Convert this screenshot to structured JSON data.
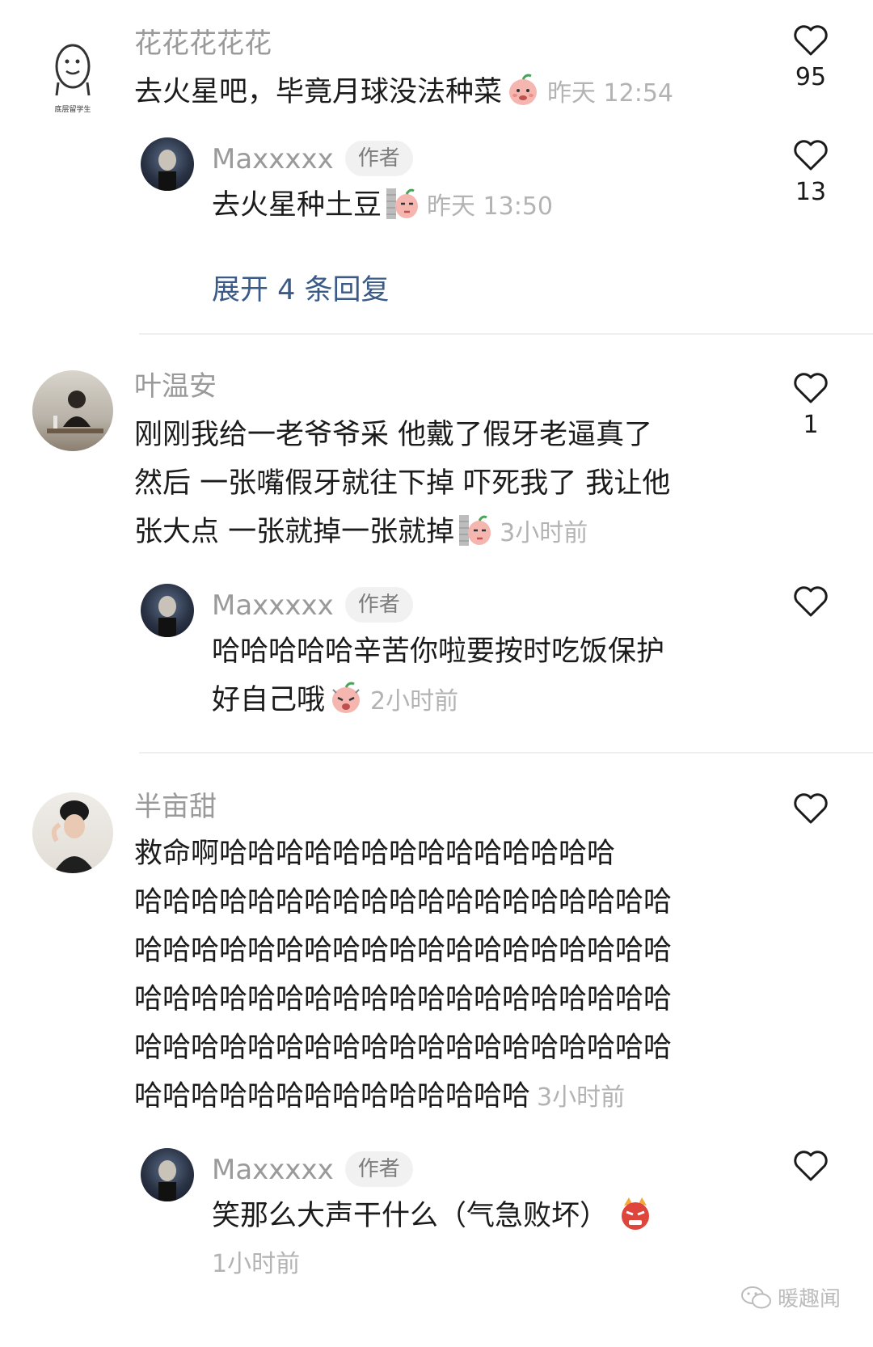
{
  "comments": [
    {
      "user": "花花花花花",
      "text": "去火星吧，毕竟月球没法种菜",
      "time": "昨天 12:54",
      "likes": "95",
      "avatar_label": "底层留学生",
      "reply": {
        "user": "Maxxxxx",
        "author_tag": "作者",
        "text": "去火星种土豆",
        "time": "昨天 13:50",
        "likes": "13"
      },
      "expand_label": "展开 4 条回复"
    },
    {
      "user": "叶温安",
      "lines": [
        "刚刚我给一老爷爷采 他戴了假牙老逼真了",
        "然后 一张嘴假牙就往下掉 吓死我了 我让他",
        "张大点 一张就掉一张就掉"
      ],
      "time": "3小时前",
      "likes": "1",
      "reply": {
        "user": "Maxxxxx",
        "author_tag": "作者",
        "lines": [
          "哈哈哈哈哈辛苦你啦要按时吃饭保护",
          "好自己哦"
        ],
        "time": "2小时前"
      }
    },
    {
      "user": "半亩甜",
      "lines": [
        "救命啊哈哈哈哈哈哈哈哈哈哈哈哈哈哈",
        "哈哈哈哈哈哈哈哈哈哈哈哈哈哈哈哈哈哈哈",
        "哈哈哈哈哈哈哈哈哈哈哈哈哈哈哈哈哈哈哈",
        "哈哈哈哈哈哈哈哈哈哈哈哈哈哈哈哈哈哈哈",
        "哈哈哈哈哈哈哈哈哈哈哈哈哈哈哈哈哈哈哈",
        "哈哈哈哈哈哈哈哈哈哈哈哈哈哈"
      ],
      "time": "3小时前",
      "reply": {
        "user": "Maxxxxx",
        "author_tag": "作者",
        "text": "笑那么大声干什么（气急败坏）",
        "time": "1小时前"
      }
    }
  ],
  "watermark": "暖趣闻",
  "colors": {
    "name": "#9a9a9a",
    "link": "#3a5a87",
    "time": "#b3b3b3",
    "tag_bg": "#f1f1f1"
  }
}
